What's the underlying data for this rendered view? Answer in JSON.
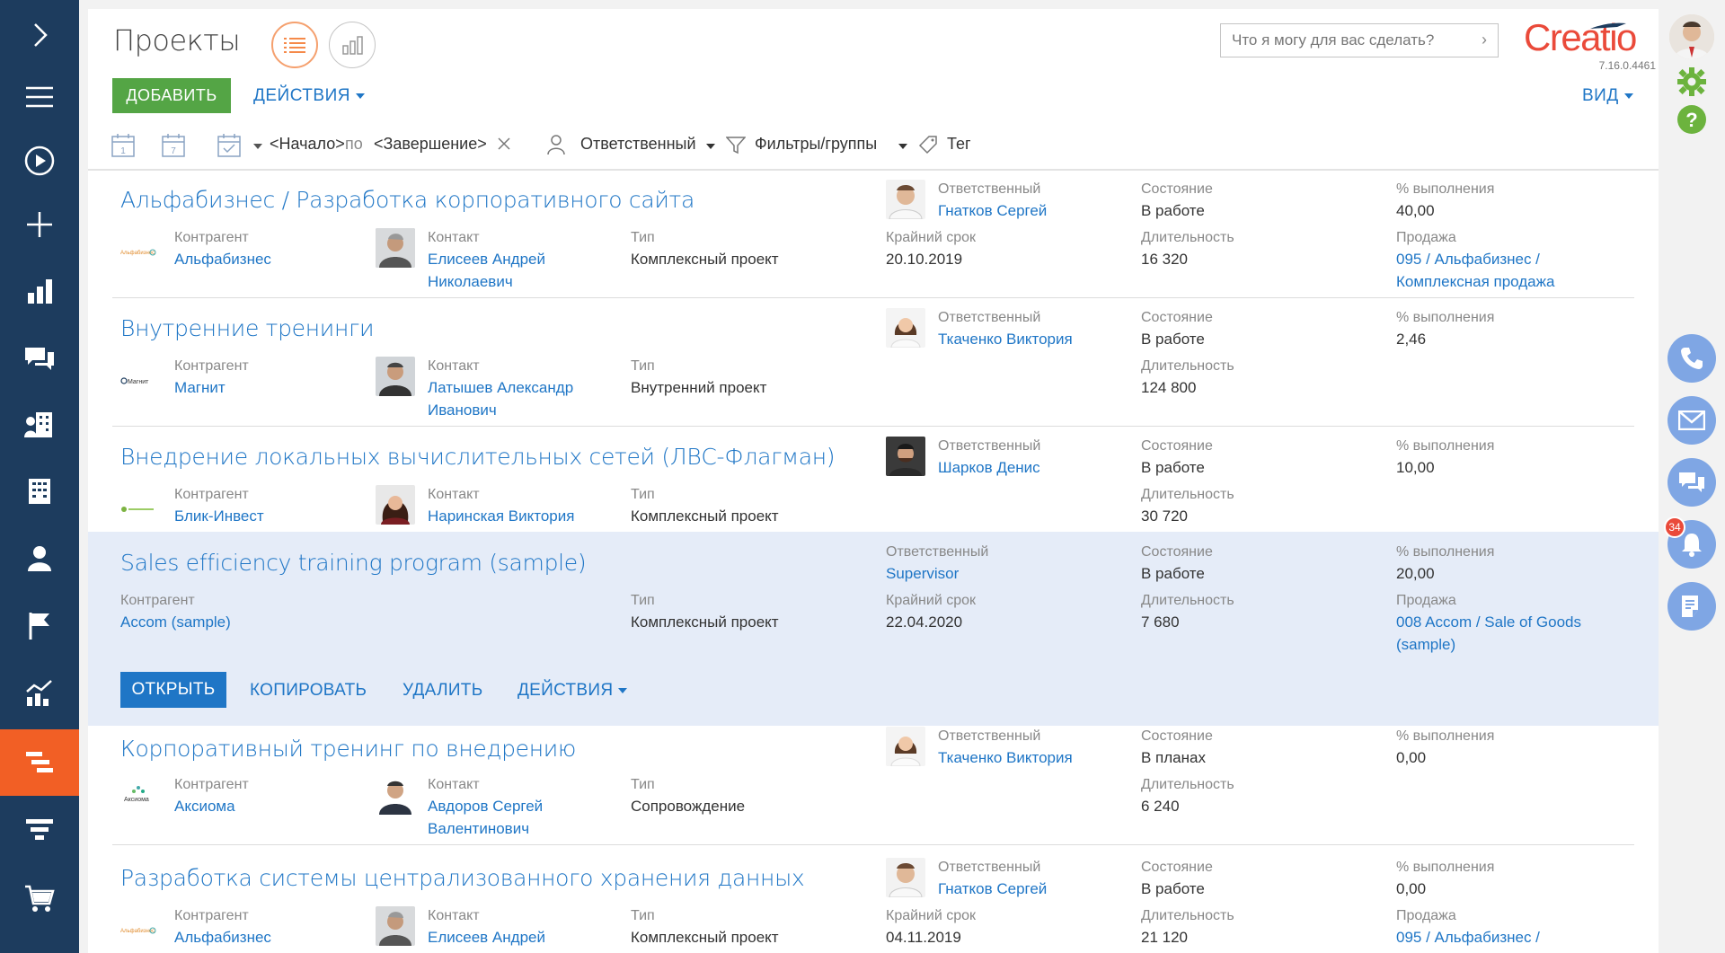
{
  "nav": {
    "items": [
      "menu-toggle",
      "main-menu",
      "process-run",
      "add-new",
      "dashboards",
      "feed",
      "accounts",
      "contacts-building",
      "contacts",
      "leads",
      "analytics",
      "projects",
      "funnel",
      "orders"
    ],
    "active": "projects"
  },
  "header": {
    "title": "Проекты",
    "add_label": "ДОБАВИТЬ",
    "actions_label": "ДЕЙСТВИЯ",
    "search_placeholder": "Что я могу для вас сделать?",
    "logo_text": "Creatio",
    "version": "7.16.0.4461",
    "view_label": "ВИД",
    "accent_color": "#f25f25",
    "link_color": "#1f76c6",
    "add_color": "#54a545"
  },
  "filters": {
    "start": "<Начало>",
    "between": "по",
    "end": "<Завершение>",
    "owner": "Ответственный",
    "groups": "Фильтры/группы",
    "tag": "Тег"
  },
  "labels": {
    "owner": "Ответственный",
    "state": "Состояние",
    "progress": "% выполнения",
    "account": "Контрагент",
    "contact": "Контакт",
    "type": "Тип",
    "deadline": "Крайний срок",
    "duration": "Длительность",
    "sale": "Продажа"
  },
  "rows": [
    {
      "title": "Альфабизнес / Разработка корпоративного сайта",
      "owner": "Гнатков Сергей",
      "state": "В работе",
      "progress": "40,00",
      "account": "Альфабизнес",
      "contact1": "Елисеев Андрей",
      "contact2": "Николаевич",
      "type": "Комплексный проект",
      "deadline": "20.10.2019",
      "duration": "16 320",
      "sale1": "095 / Альфабизнес /",
      "sale2": "Комплексная продажа"
    },
    {
      "title": "Внутренние тренинги",
      "owner": "Ткаченко Виктория",
      "state": "В работе",
      "progress": "2,46",
      "account": "Магнит",
      "account_logo": "Магнит",
      "contact1": "Латышев Александр",
      "contact2": "Иванович",
      "type": "Внутренний проект",
      "duration": "124 800"
    },
    {
      "title": "Внедрение локальных вычислительных сетей (ЛВС-Флагман)",
      "owner": "Шарков Денис",
      "state": "В работе",
      "progress": "10,00",
      "account": "Блик-Инвест",
      "contact1": "Наринская Виктория",
      "type": "Комплексный проект",
      "duration": "30 720"
    },
    {
      "title": "Sales efficiency training program (sample)",
      "owner": "Supervisor",
      "state": "В работе",
      "progress": "20,00",
      "account": "Accom (sample)",
      "type": "Комплексный проект",
      "deadline": "22.04.2020",
      "duration": "7 680",
      "sale1": "008 Accom / Sale of Goods",
      "sale2": "(sample)",
      "open_label": "ОТКРЫТЬ",
      "copy_label": "КОПИРОВАТЬ",
      "delete_label": "УДАЛИТЬ",
      "actions_label": "ДЕЙСТВИЯ"
    },
    {
      "title": "Корпоративный тренинг по внедрению",
      "owner": "Ткаченко Виктория",
      "state": "В планах",
      "progress": "0,00",
      "account": "Аксиома",
      "account_logo": "Аксиома",
      "contact1": "Авдоров Сергей",
      "contact2": "Валентинович",
      "type": "Сопровождение",
      "duration": "6 240"
    },
    {
      "title": "Разработка системы централизованного хранения данных",
      "owner": "Гнатков Сергей",
      "state": "В работе",
      "progress": "0,00",
      "account": "Альфабизнес",
      "contact1": "Елисеев Андрей",
      "type": "Комплексный проект",
      "deadline": "04.11.2019",
      "duration": "21 120",
      "sale1": "095 / Альфабизнес /"
    }
  ],
  "right_panel": {
    "notifications_count": "34"
  }
}
